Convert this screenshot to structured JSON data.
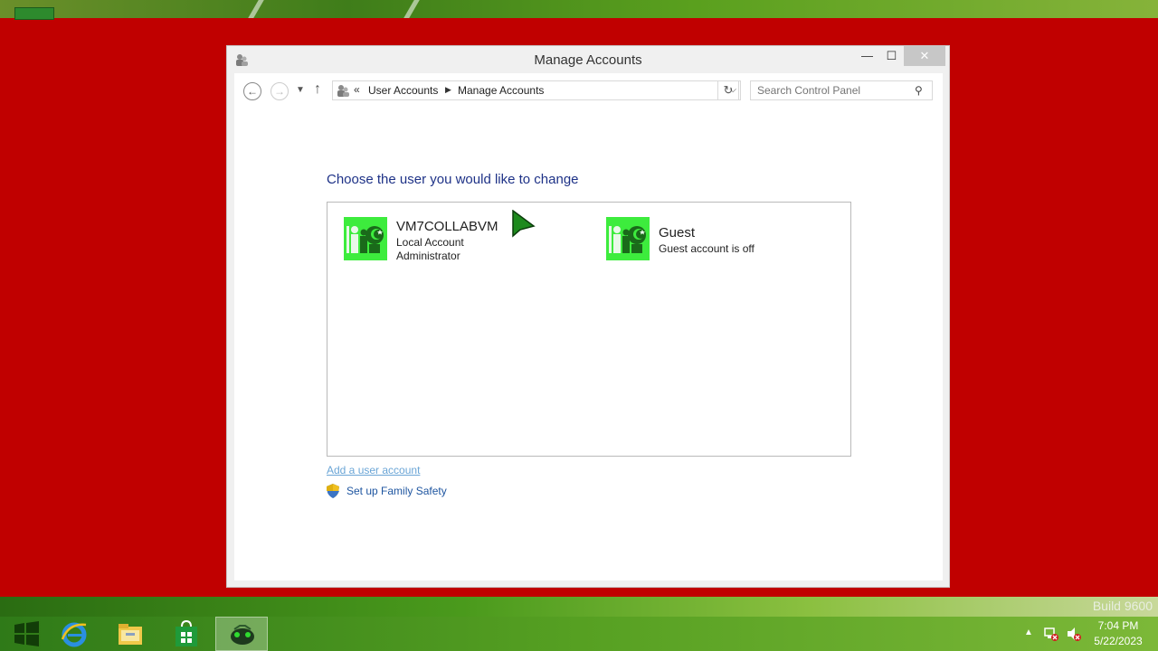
{
  "desktop": {
    "watermark": "Build 9600"
  },
  "window": {
    "title": "Manage Accounts",
    "controls": {
      "minimize": "—",
      "maximize": "☐",
      "close": "✕"
    }
  },
  "address_bar": {
    "overflow_chevron": "«",
    "breadcrumb": [
      "User Accounts",
      "Manage Accounts"
    ],
    "search_placeholder": "Search Control Panel"
  },
  "main": {
    "heading": "Choose the user you would like to change",
    "accounts": [
      {
        "name": "VM7COLLABVM",
        "line1": "Local Account",
        "line2": "Administrator"
      },
      {
        "name": "Guest",
        "line1": "Guest account is off"
      }
    ],
    "links": {
      "add_user": "Add a user account",
      "family_safety": "Set up Family Safety"
    }
  },
  "taskbar": {
    "pinned": [
      "start-icon",
      "internet-explorer-icon",
      "file-explorer-icon",
      "store-icon",
      "user-accounts-app-icon"
    ],
    "clock": {
      "time": "7:04 PM",
      "date": "5/22/2023"
    }
  },
  "colors": {
    "desktop_background": "#c00000",
    "heading": "#1e3287",
    "avatar": "#3dec3d",
    "link": "#1e55a0"
  }
}
